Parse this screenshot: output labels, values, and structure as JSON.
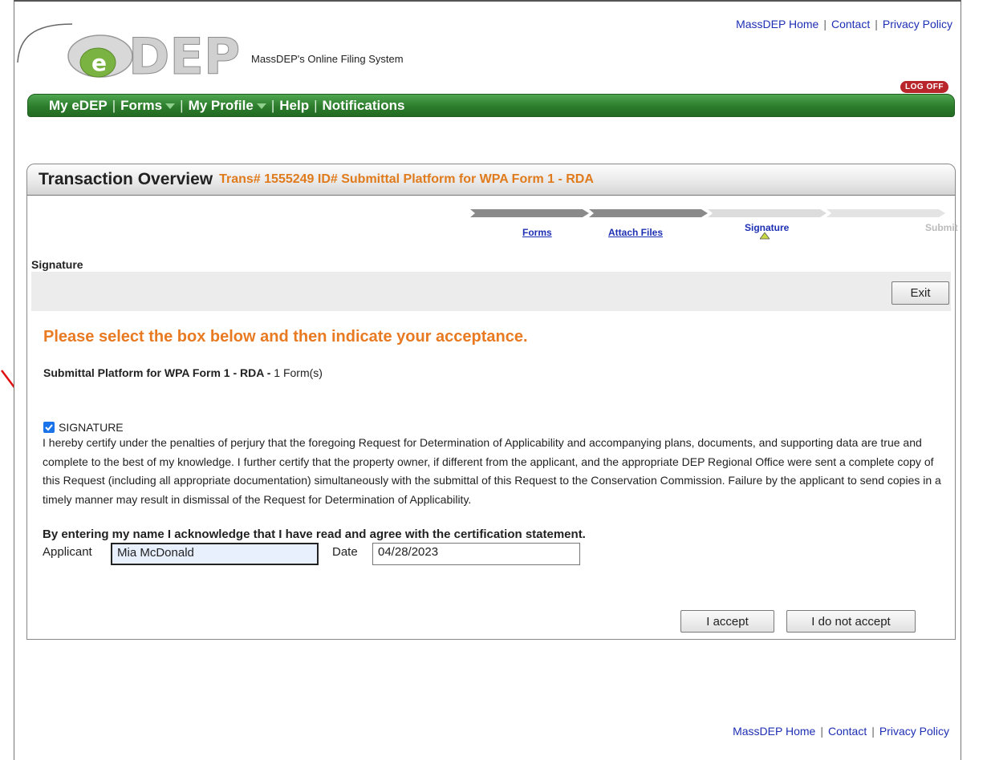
{
  "header": {
    "links": [
      "MassDEP Home",
      "Contact",
      "Privacy Policy"
    ],
    "logo_text": "DEP",
    "logo_letter": "e",
    "tagline": "MassDEP's Online Filing System",
    "logoff_label": "LOG OFF"
  },
  "nav": {
    "items": [
      "My  eDEP",
      "Forms",
      "My  Profile",
      "Help",
      "Notifications"
    ]
  },
  "panel": {
    "title": "Transaction Overview",
    "trans_info": "Trans# 1555249 ID# Submittal Platform for WPA Form 1 - RDA",
    "steps": [
      "Forms",
      "Attach Files",
      "Signature",
      "Submit"
    ],
    "section_title": "Signature",
    "exit_label": "Exit",
    "heading": "Please select the box below and then indicate your acceptance.",
    "submittal_name": "Submittal Platform for WPA Form 1 - RDA",
    "submittal_sep": " - ",
    "submittal_count": "1 Form(s)",
    "checkbox_label": "SIGNATURE",
    "checkbox_checked": true,
    "certification": "I hereby certify under the penalties of perjury that the foregoing Request for Determination of Applicability and accompanying plans, documents, and supporting data are true and complete to the best of my knowledge. I further certify that the property owner, if different from the applicant, and the appropriate DEP Regional Office were sent a complete copy of this Request (including all appropriate documentation) simultaneously with the submittal of this Request to the Conservation Commission. Failure by the applicant to send copies in a timely manner may result in dismissal of the Request for Determination of Applicability.",
    "acknowledge": "By entering my name I acknowledge that I have read and agree with the certification statement.",
    "applicant_label": "Applicant",
    "applicant_value": "Mia McDonald",
    "date_label": "Date",
    "date_value": "04/28/2023",
    "accept_label": "I accept",
    "decline_label": "I do not accept"
  },
  "footer": {
    "links": [
      "MassDEP Home",
      "Contact",
      "Privacy Policy"
    ]
  },
  "colors": {
    "accent_orange": "#e87a22",
    "nav_green": "#2c7c2c",
    "link_blue": "#1d2fb3",
    "checkbox_blue": "#1a73e8",
    "annotation_red": "#e01010"
  }
}
